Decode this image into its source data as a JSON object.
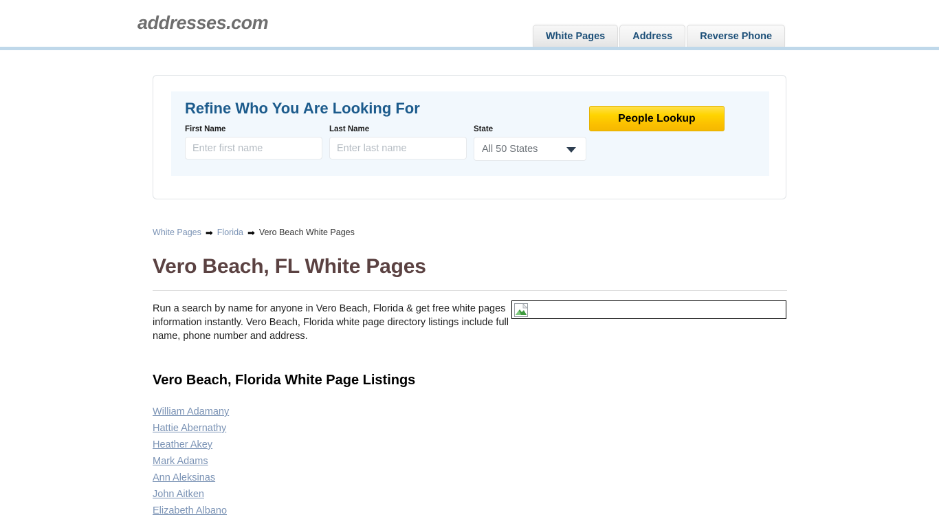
{
  "header": {
    "logo": "addresses.com",
    "tabs": [
      {
        "label": "White Pages",
        "active": true
      },
      {
        "label": "Address",
        "active": false
      },
      {
        "label": "Reverse Phone",
        "active": false
      }
    ]
  },
  "search": {
    "title": "Refine Who You Are Looking For",
    "first_name": {
      "label": "First Name",
      "placeholder": "Enter first name",
      "value": ""
    },
    "last_name": {
      "label": "Last Name",
      "placeholder": "Enter last name",
      "value": ""
    },
    "state": {
      "label": "State",
      "selected": "All 50 States"
    },
    "submit_label": "People Lookup"
  },
  "breadcrumb": {
    "items": [
      "White Pages",
      "Florida",
      "Vero Beach White Pages"
    ],
    "separator": "➡"
  },
  "main": {
    "page_title": "Vero Beach, FL White Pages",
    "description": "Run a search by name for anyone in Vero Beach, Florida & get free white pages information instantly. Vero Beach, Florida white page directory listings include full name, phone number and address.",
    "listings_title": "Vero Beach, Florida White Page Listings",
    "listings": [
      "William Adamany",
      "Hattie Abernathy",
      "Heather Akey",
      "Mark Adams",
      "Ann Aleksinas",
      "John Aitken",
      "Elizabeth Albano"
    ]
  },
  "colors": {
    "tab_text": "#1c4f78",
    "heading_blue": "#1c5b8c",
    "title_maroon": "#5b4242",
    "link_blue": "#7b93b5",
    "button_yellow": "#ffd400",
    "header_rule": "#bfd8ea"
  }
}
